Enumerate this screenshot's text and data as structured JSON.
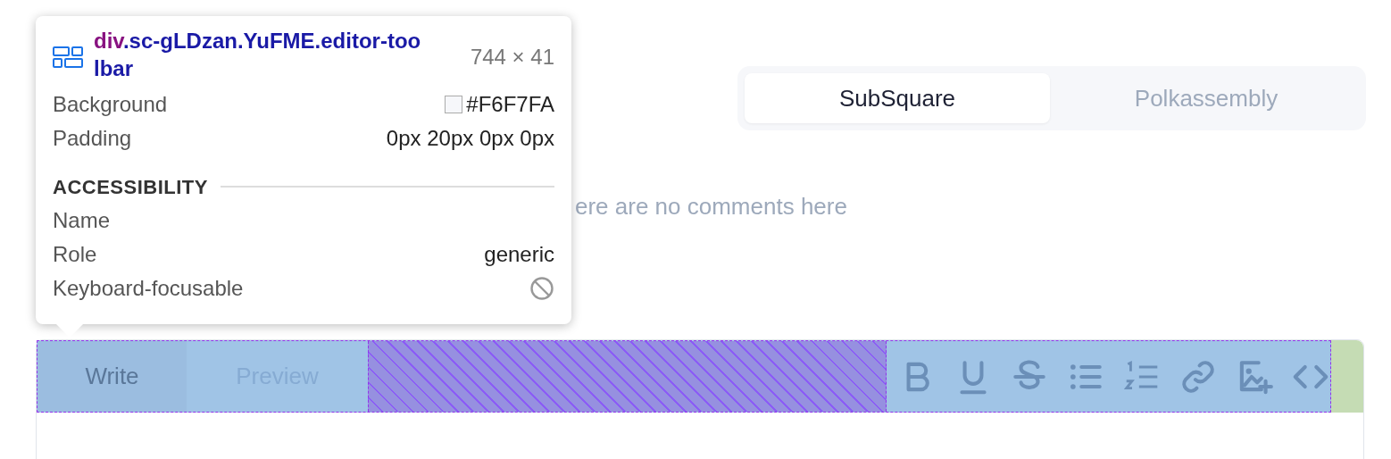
{
  "source_tabs": [
    {
      "label": "SubSquare",
      "selected": true
    },
    {
      "label": "Polkassembly",
      "selected": false
    }
  ],
  "empty_message": "ere are no comments here",
  "editor": {
    "mode_tabs": [
      {
        "label": "Write",
        "selected": true
      },
      {
        "label": "Preview",
        "selected": false
      }
    ]
  },
  "inspector_tooltip": {
    "selector_tag": "div",
    "selector_classes": ".sc-gLDzan.YuFME.editor-toolbar",
    "size": "744 × 41",
    "styles": [
      {
        "label": "Background",
        "value": "#F6F7FA",
        "kind": "color"
      },
      {
        "label": "Padding",
        "value": "0px 20px 0px 0px",
        "kind": "text"
      }
    ],
    "accessibility_heading": "ACCESSIBILITY",
    "accessibility": [
      {
        "label": "Name",
        "kind": "text"
      },
      {
        "label": "Role",
        "value": "generic",
        "kind": "text"
      },
      {
        "label": "Keyboard-focusable",
        "kind": "flag",
        "on": false
      }
    ]
  }
}
